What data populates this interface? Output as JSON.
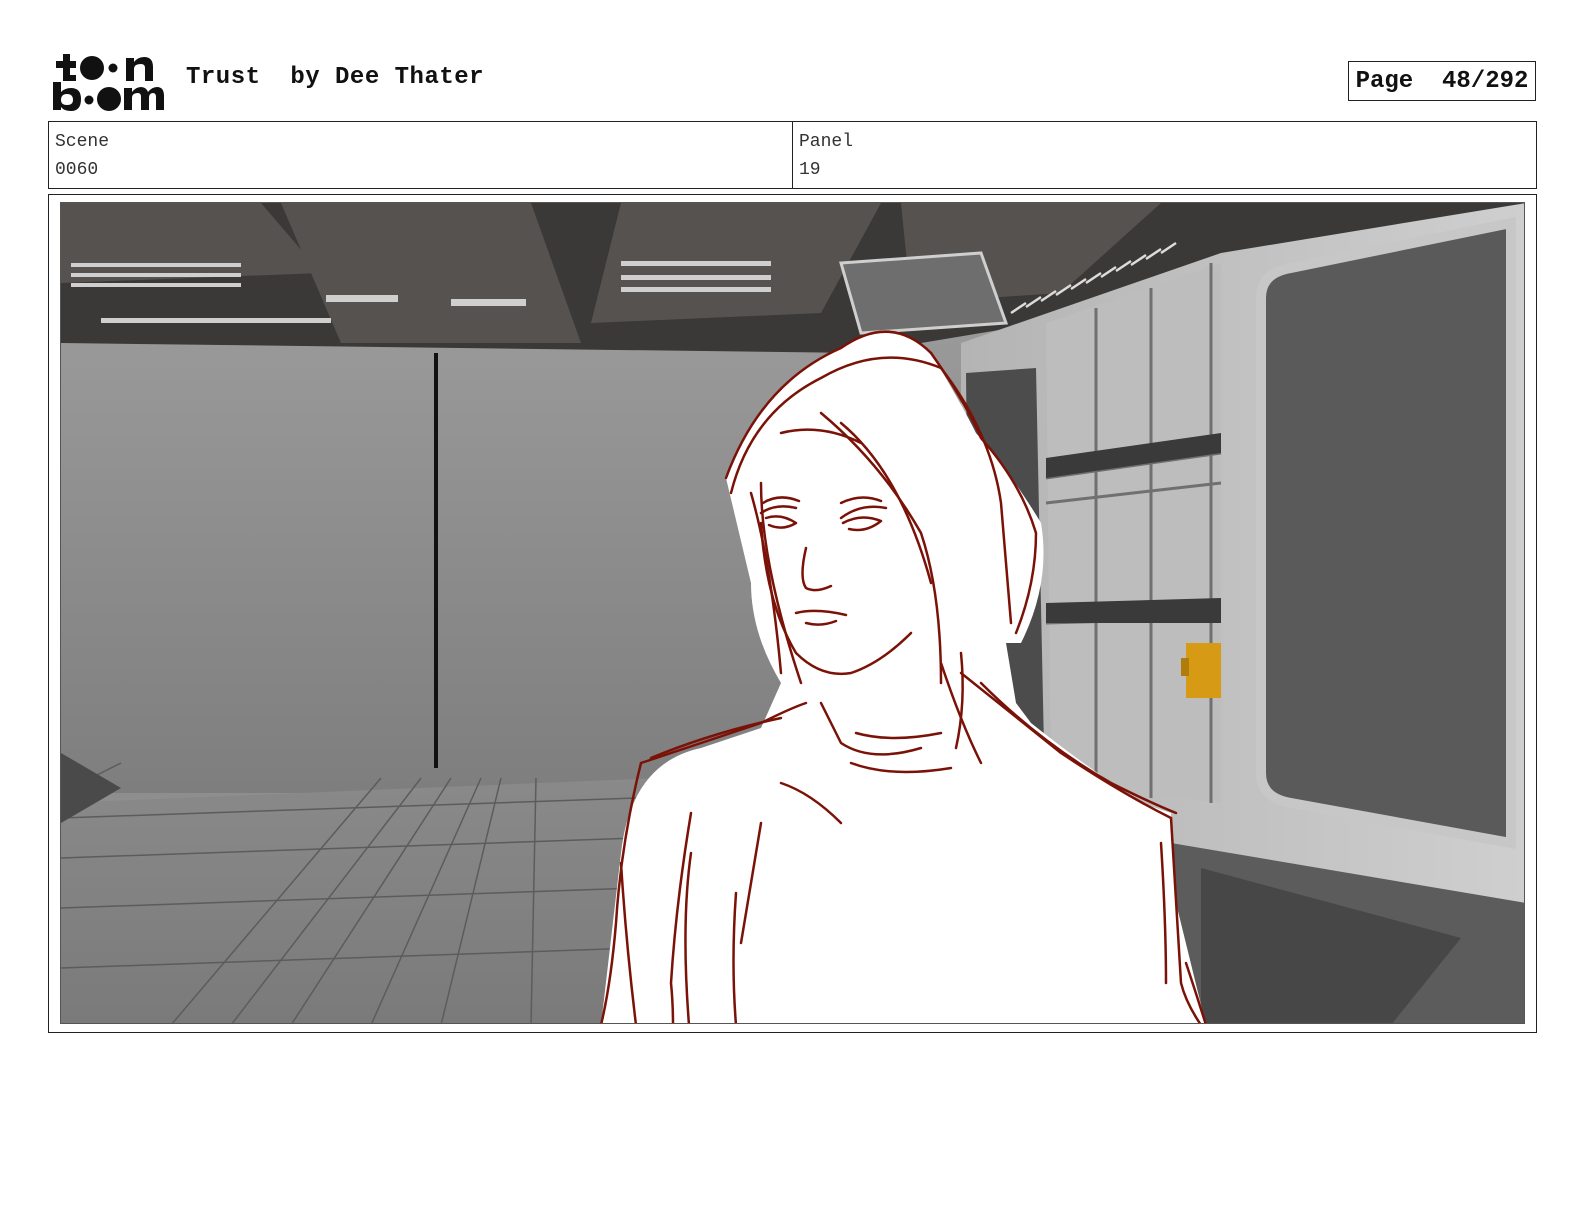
{
  "header": {
    "logo_text": "toon boom",
    "title": "Trust  by Dee Thater",
    "page_label": "Page",
    "page_number": "48/292"
  },
  "info": {
    "scene_label": "Scene",
    "scene_value": "0060",
    "panel_label": "Panel",
    "panel_value": "19"
  },
  "panel": {
    "image_subject": "storyboard-sketch-character-in-spaceship-corridor",
    "sketch_color": "#7a1208"
  }
}
